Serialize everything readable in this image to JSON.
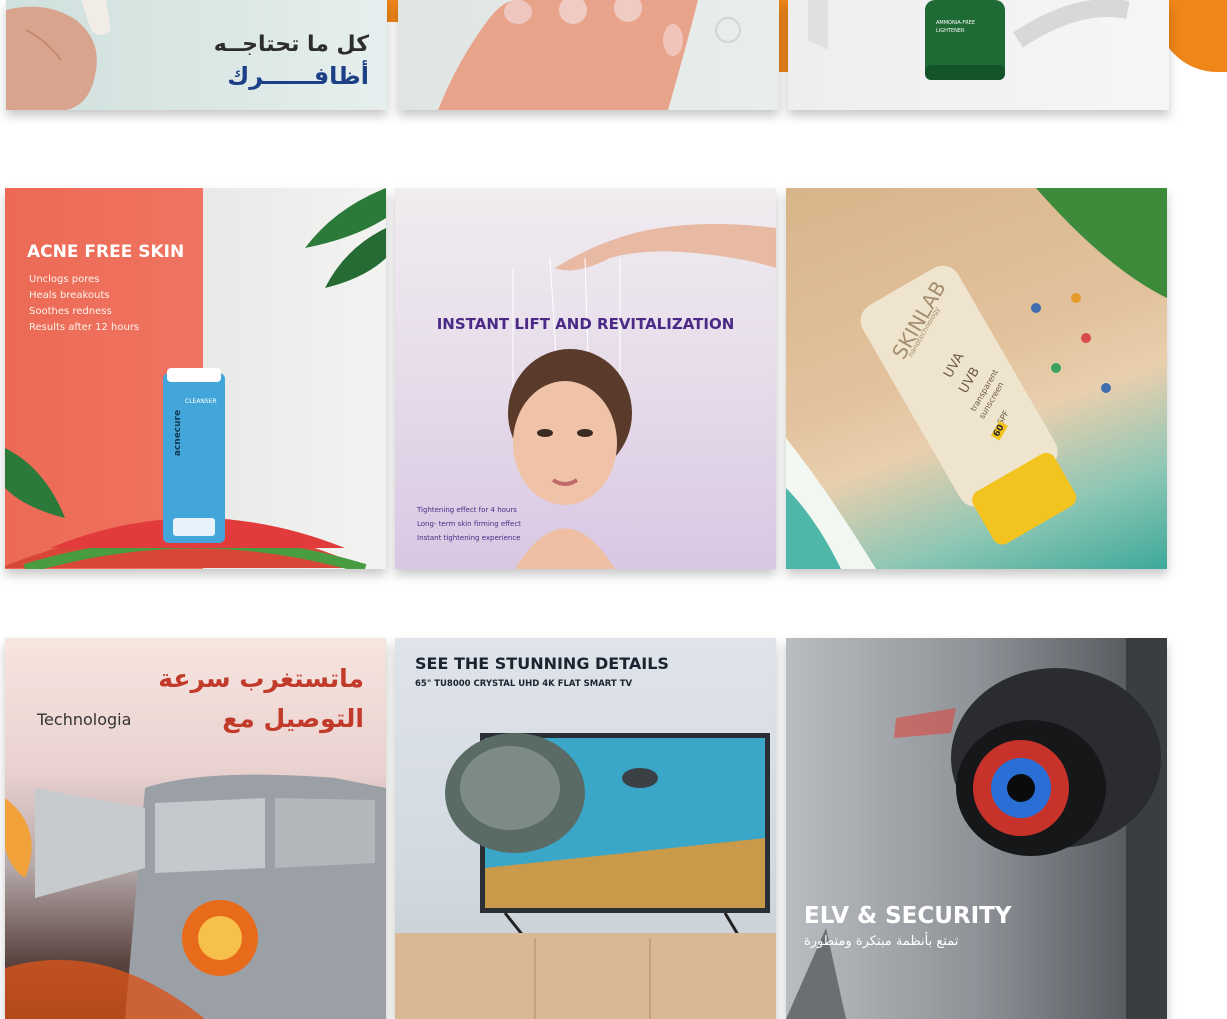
{
  "grid": {
    "row1": {
      "tile1": {
        "title_line1": "كل ما تحتاجــه",
        "title_line2": "أظافــــــرك"
      },
      "tile2": {
        "subject": "manicured nails"
      },
      "tile3": {
        "product_lines": [
          "AMMONIA-FREE",
          "LIGHTENER"
        ]
      }
    },
    "row2": {
      "tile1": {
        "headline": "ACNE FREE SKIN",
        "bullets": [
          "Unclogs pores",
          "Heals breakouts",
          "Soothes redness",
          "Results after 12 hours"
        ],
        "brand": "acnecure",
        "product_label": "CLEANSER"
      },
      "tile2": {
        "headline": "INSTANT LIFT AND REVITALIZATION",
        "bullets": [
          "Tightening effect for 4 hours",
          "Long- term skin firming effect",
          "Instant tightening experience"
        ]
      },
      "tile3": {
        "brand": "SKINLAB",
        "tagline": "nanotechnology",
        "lines": [
          "UVA",
          "UVB",
          "transparent",
          "sunscreen"
        ],
        "spf_label": "SPF",
        "spf_value": "60"
      }
    },
    "row3": {
      "tile1": {
        "line1": "ماتستغرب سرعة",
        "line2": "التوصيل مع",
        "brand": "Technologia"
      },
      "tile2": {
        "headline": "SEE THE STUNNING DETAILS",
        "subhead": "65\" TU8000 CRYSTAL UHD 4K FLAT SMART TV"
      },
      "tile3": {
        "headline": "ELV & SECURITY",
        "subtitle": "تمتع بأنظمة مبتكرة ومتطورة"
      }
    }
  },
  "colors": {
    "accent_orange": "#ee8619",
    "acne_red": "#e8624f",
    "lift_purple": "#4b2a87",
    "tech_red": "#c23a2a"
  }
}
